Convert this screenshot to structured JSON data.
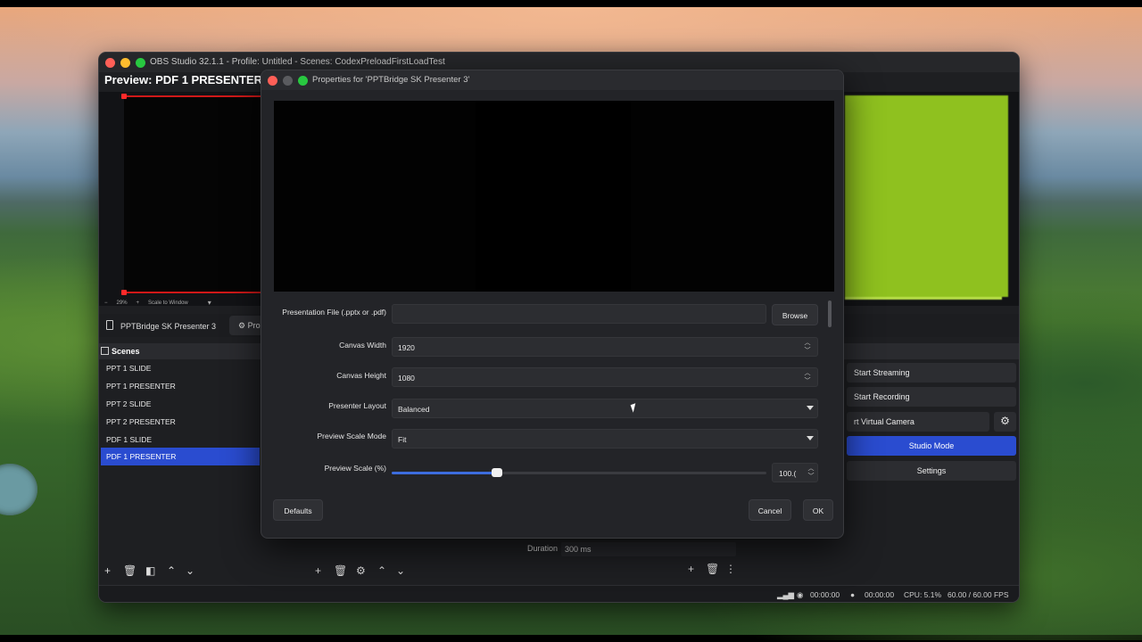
{
  "window": {
    "title": "OBS Studio 32.1.1 - Profile: Untitled - Scenes: CodexPreloadFirstLoadTest"
  },
  "preview": {
    "title": "Preview: PDF 1 PRESENTER",
    "zoom": "29%",
    "scale_mode": "Scale to Window"
  },
  "source_bar": {
    "source_name": "PPTBridge SK Presenter 3",
    "properties_label": "Prop"
  },
  "scenes": {
    "header": "Scenes",
    "items": [
      {
        "label": "PPT 1 SLIDE"
      },
      {
        "label": "PPT 1 PRESENTER"
      },
      {
        "label": "PPT 2 SLIDE"
      },
      {
        "label": "PPT 2 PRESENTER"
      },
      {
        "label": "PDF 1 SLIDE"
      },
      {
        "label": "PDF 1 PRESENTER"
      }
    ],
    "selected": "PDF 1 PRESENTER"
  },
  "controls": {
    "start_streaming": "Start Streaming",
    "start_recording": "Start Recording",
    "virtual_camera": "rt Virtual Camera",
    "studio_mode": "Studio Mode",
    "settings": "Settings"
  },
  "transition": {
    "duration_label": "Duration",
    "duration_value": "300 ms"
  },
  "status": {
    "stream_time": "00:00:00",
    "record_time": "00:00:00",
    "cpu": "CPU: 5.1%",
    "fps": "60.00 / 60.00 FPS"
  },
  "dialog": {
    "title": "Properties for 'PPTBridge SK Presenter 3'",
    "presentation_file_label": "Presentation File (.pptx or .pdf)",
    "presentation_file_value": "",
    "browse": "Browse",
    "canvas_width_label": "Canvas Width",
    "canvas_width": "1920",
    "canvas_height_label": "Canvas Height",
    "canvas_height": "1080",
    "presenter_layout_label": "Presenter Layout",
    "presenter_layout": "Balanced",
    "preview_scale_mode_label": "Preview Scale Mode",
    "preview_scale_mode": "Fit",
    "preview_scale_label": "Preview Scale (%)",
    "preview_scale_value": "100.(",
    "preview_scale_fraction": 0.28,
    "defaults": "Defaults",
    "cancel": "Cancel",
    "ok": "OK"
  },
  "colors": {
    "accent": "#2a4cd0",
    "program_green": "#8fc11f",
    "red_outline": "#d01818"
  }
}
